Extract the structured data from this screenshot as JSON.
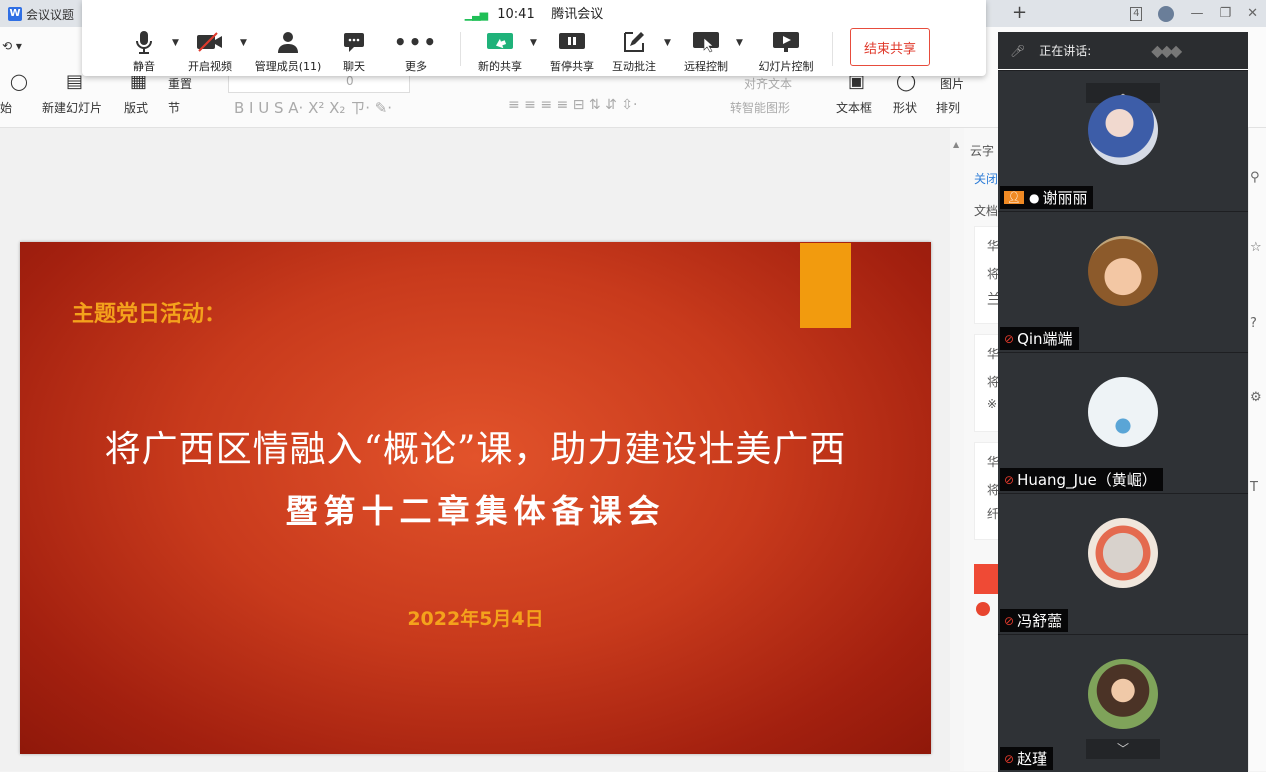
{
  "window": {
    "tab_title": "会议议题",
    "new_tab": "+",
    "page_count": "4"
  },
  "ribbon": {
    "start": "始",
    "new_slide": "新建幻灯片",
    "layout": "版式",
    "section": "节",
    "reset": "重置",
    "font_size": "0",
    "smartart": "转智能图形",
    "textbox": "文本框",
    "shape": "形状",
    "arrange": "排列",
    "picture": "图片",
    "align_text": "对齐文本"
  },
  "meeting": {
    "time": "10:41",
    "app_name": "腾讯会议",
    "buttons": {
      "mute": "静音",
      "video": "开启视频",
      "members": "管理成员(11)",
      "chat": "聊天",
      "more": "更多",
      "new_share": "新的共享",
      "pause_share": "暂停共享",
      "annotate": "互动批注",
      "remote_control": "远程控制",
      "slide_control": "幻灯片控制"
    },
    "end_share": "结束共享",
    "speaking_label": "正在讲话:"
  },
  "slide": {
    "subtitle": "主题党日活动：",
    "title": "将广西区情融入“概论”课，助力建设壮美广西",
    "title2": "暨第十二章集体备课会",
    "date": "2022年5月4日"
  },
  "right_panel": {
    "heading": "云字",
    "close": "关闭",
    "doc": "文档",
    "items": [
      {
        "l1": "华",
        "l2": "将",
        "l3": "兰"
      },
      {
        "l1": "华",
        "l2": "将",
        "l3": "※"
      },
      {
        "l1": "华",
        "l2": "将",
        "l3": "纤"
      }
    ]
  },
  "participants": [
    {
      "name": "谢丽丽",
      "host": true,
      "mic": "on"
    },
    {
      "name": "Qin端端",
      "host": false,
      "mic": "off"
    },
    {
      "name": "Huang_Jue（黄崛）",
      "host": false,
      "mic": "off"
    },
    {
      "name": "冯舒蘦",
      "host": false,
      "mic": "off"
    },
    {
      "name": "赵瑾",
      "host": false,
      "mic": "off"
    }
  ],
  "colors": {
    "slide_red": "#c83a1c",
    "slide_orange": "#f29b0e",
    "end_share_red": "#e03a2c",
    "signal_green": "#1fbf56",
    "tile_bg": "#2f3236"
  }
}
